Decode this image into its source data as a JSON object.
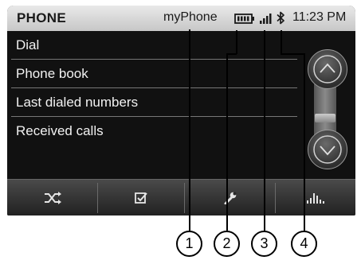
{
  "statusbar": {
    "title": "PHONE",
    "device_name": "myPhone",
    "battery_icon": "battery-icon",
    "signal_icon": "signal-strength-icon",
    "bluetooth_icon": "bluetooth-icon",
    "time": "11:23 PM"
  },
  "menu": {
    "items": [
      {
        "label": "Dial"
      },
      {
        "label": "Phone book"
      },
      {
        "label": "Last dialed numbers"
      },
      {
        "label": "Received calls"
      }
    ]
  },
  "scroll": {
    "up_icon": "chevron-up-icon",
    "down_icon": "chevron-down-icon"
  },
  "toolbar": {
    "buttons": [
      {
        "icon": "shuffle-icon"
      },
      {
        "icon": "checkbox-icon"
      },
      {
        "icon": "wrench-icon"
      },
      {
        "icon": "equalizer-icon"
      }
    ]
  },
  "callouts": [
    "1",
    "2",
    "3",
    "4"
  ],
  "colors": {
    "statusbar": "#d6d6d6",
    "background": "#111111",
    "text": "#f2f2f2"
  }
}
